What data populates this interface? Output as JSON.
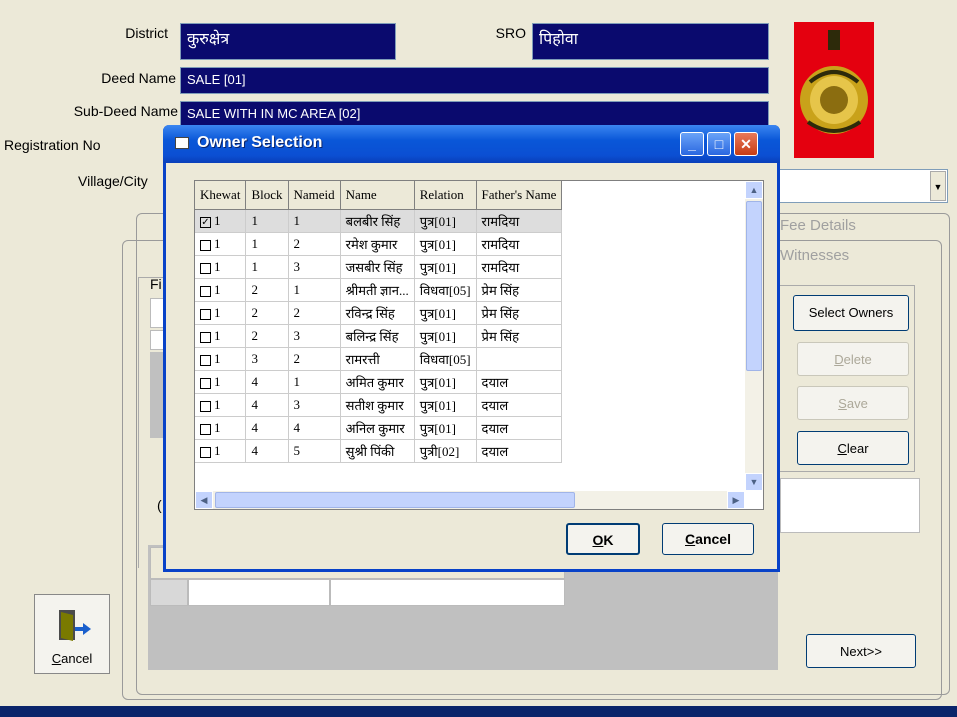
{
  "form": {
    "district_label": "District",
    "district_value": "कुरुक्षेत्र",
    "sro_label": "SRO",
    "sro_value": "पिहोवा",
    "deed_name_label": "Deed Name",
    "deed_name_value": "SALE [01]",
    "sub_deed_label": "Sub-Deed Name",
    "sub_deed_value": "SALE WITH IN MC AREA [02]",
    "registration_label": "Registration No",
    "village_label": "Village/City"
  },
  "tabs": {
    "fee_details": "Fee Details",
    "witnesses": "Witnesses",
    "fi_label": "Fi"
  },
  "buttons": {
    "select_owners": "Select Owners",
    "delete": "Delete",
    "save": "Save",
    "clear": "Clear",
    "next": "Next>>",
    "cancel": "Cancel"
  },
  "dialog": {
    "title": "Owner Selection",
    "ok": "OK",
    "cancel": "Cancel",
    "columns": [
      "Khewat",
      "Block",
      "Nameid",
      "Name",
      "Relation",
      "Father's Name"
    ],
    "rows": [
      {
        "checked": true,
        "khewat": "1",
        "block": "1",
        "nameid": "1",
        "name": "बलबीर सिंह",
        "relation": "पुत्र[01]",
        "father": "रामदिया"
      },
      {
        "checked": false,
        "khewat": "1",
        "block": "1",
        "nameid": "2",
        "name": "रमेश कुमार",
        "relation": "पुत्र[01]",
        "father": "रामदिया"
      },
      {
        "checked": false,
        "khewat": "1",
        "block": "1",
        "nameid": "3",
        "name": "जसबीर सिंह",
        "relation": "पुत्र[01]",
        "father": "रामदिया"
      },
      {
        "checked": false,
        "khewat": "1",
        "block": "2",
        "nameid": "1",
        "name": "श्रीमती ज्ञान...",
        "relation": "विधवा[05]",
        "father": "प्रेम सिंह"
      },
      {
        "checked": false,
        "khewat": "1",
        "block": "2",
        "nameid": "2",
        "name": "रविन्द्र सिंह",
        "relation": "पुत्र[01]",
        "father": "प्रेम सिंह"
      },
      {
        "checked": false,
        "khewat": "1",
        "block": "2",
        "nameid": "3",
        "name": "बलिन्द्र सिंह",
        "relation": "पुत्र[01]",
        "father": "प्रेम सिंह"
      },
      {
        "checked": false,
        "khewat": "1",
        "block": "3",
        "nameid": "2",
        "name": "रामरत्ती",
        "relation": "विधवा[05]",
        "father": ""
      },
      {
        "checked": false,
        "khewat": "1",
        "block": "4",
        "nameid": "1",
        "name": "अमित कुमार",
        "relation": "पुत्र[01]",
        "father": "दयाल"
      },
      {
        "checked": false,
        "khewat": "1",
        "block": "4",
        "nameid": "3",
        "name": "सतीश कुमार",
        "relation": "पुत्र[01]",
        "father": "दयाल"
      },
      {
        "checked": false,
        "khewat": "1",
        "block": "4",
        "nameid": "4",
        "name": "अनिल कुमार",
        "relation": "पुत्र[01]",
        "father": "दयाल"
      },
      {
        "checked": false,
        "khewat": "1",
        "block": "4",
        "nameid": "5",
        "name": "सुश्री पिंकी",
        "relation": "पुत्री[02]",
        "father": "दयाल"
      }
    ]
  },
  "icons": {
    "emblem": "haryana-emblem-icon",
    "exit_door": "exit-door-icon"
  },
  "colors": {
    "field_bg": "#0a0a6e",
    "title_bar": "#0b4fd3",
    "close_red": "#c73c14",
    "emblem_bg": "#e4000f"
  }
}
